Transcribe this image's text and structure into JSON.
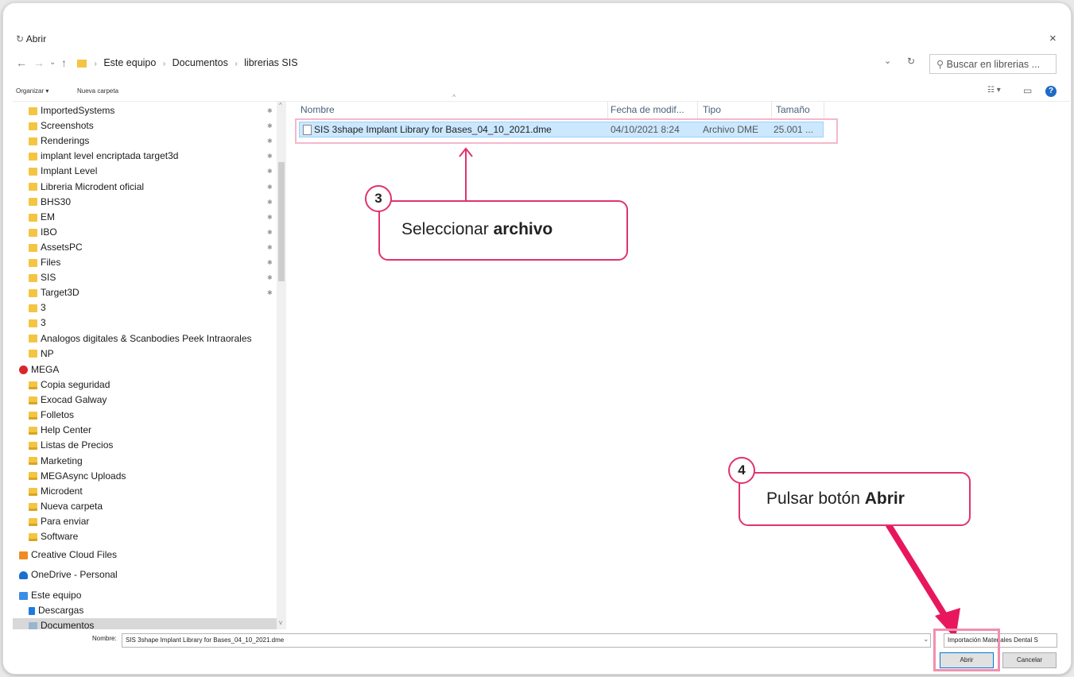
{
  "window": {
    "title": "Abrir",
    "close": "×"
  },
  "nav": {
    "back": "←",
    "forward": "→",
    "dropdown": "⌄",
    "up": "↑"
  },
  "address": {
    "crumbs": [
      "Este equipo",
      "Documentos",
      "librerias SIS"
    ],
    "sep": "›",
    "dropdown": "⌄",
    "refresh": "↻"
  },
  "search": {
    "placeholder": "Buscar en librerias ..."
  },
  "toolbar": {
    "organize": "Organizar ▾",
    "new_folder": "Nueva carpeta",
    "view": "☷ ▾",
    "pane": "▭",
    "help": "?"
  },
  "sidebar": {
    "quick": [
      "ImportedSystems",
      "Screenshots",
      "Renderings",
      "implant level encriptada target3d",
      "Implant Level",
      "Libreria Microdent oficial",
      "BHS30",
      "EM",
      "IBO",
      "AssetsPC",
      "Files",
      "SIS",
      "Target3D",
      "3",
      "3",
      "Analogos digitales & Scanbodies Peek Intraorales",
      "NP"
    ],
    "mega_label": "MEGA",
    "mega": [
      "Copia seguridad",
      "Exocad Galway",
      "Folletos",
      "Help Center",
      "Listas de Precios",
      "Marketing",
      "MEGAsync Uploads",
      "Microdent",
      "Nueva carpeta",
      "Para enviar",
      "Software"
    ],
    "creative": "Creative Cloud Files",
    "onedrive": "OneDrive - Personal",
    "thispc": "Este equipo",
    "descargas": "Descargas",
    "documentos": "Documentos",
    "pin": "📌",
    "scroll_up": "^",
    "scroll_down": "v"
  },
  "columns": {
    "name": "Nombre",
    "date": "Fecha de modif...",
    "type": "Tipo",
    "size": "Tamaño",
    "sort": "^"
  },
  "files": [
    {
      "name": "SIS 3shape Implant Library for Bases_04_10_2021.dme",
      "date": "04/10/2021 8:24",
      "type": "Archivo DME",
      "size": "25.001 ..."
    }
  ],
  "annotations": {
    "step3": {
      "num": "3",
      "text": "Seleccionar ",
      "bold": "archivo"
    },
    "step4": {
      "num": "4",
      "text": "Pulsar botón ",
      "bold": "Abrir"
    }
  },
  "bottom": {
    "name_label": "Nombre:",
    "name_value": "SIS 3shape Implant Library for Bases_04_10_2021.dme",
    "dropdown": "⌄",
    "filetype": "Importación Materiales Dental S",
    "open": "Abrir",
    "cancel": "Cancelar"
  },
  "colors": {
    "accent": "#e0336e",
    "selection": "#cce8ff"
  }
}
